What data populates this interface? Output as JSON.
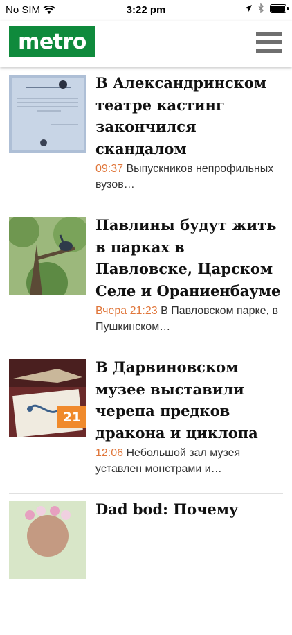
{
  "status_bar": {
    "carrier": "No SIM",
    "time": "3:22 pm"
  },
  "header": {
    "logo_text": "metro",
    "menu_icon": "hamburger-menu-icon"
  },
  "articles": [
    {
      "title": "В Александринском театре кастинг закончился скандалом",
      "time": "09:37",
      "excerpt": "Выпускников непрофильных вузов…",
      "thumbnail": "notice-paper-photo"
    },
    {
      "title": "Павлины будут жить в парках в Павловске, Царском Селе и Ораниенбауме",
      "time": "Вчера 21:23",
      "excerpt": "В Павловском парке, в Пушкинском…",
      "thumbnail": "peacock-in-tree-photo"
    },
    {
      "title": "В Дарвиновском музее выставили черепа предков дракона и циклопа",
      "time": "12:06",
      "excerpt": "Небольшой зал музея уставлен монстрами и…",
      "thumbnail": "skull-and-book-photo",
      "badge": "21"
    },
    {
      "title": "Dad bod: Почему",
      "thumbnail": "woman-flower-crown-photo"
    }
  ],
  "colors": {
    "brand_green": "#0f8a3c",
    "time_orange": "#e0763a",
    "badge_orange": "#f08a2c"
  }
}
